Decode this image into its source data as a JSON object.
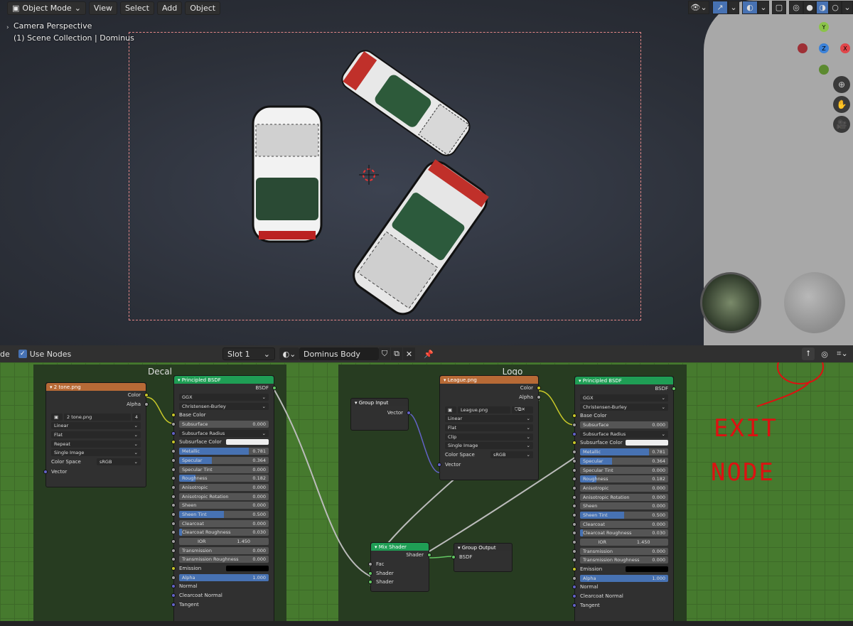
{
  "viewport": {
    "mode": "Object Mode",
    "menus": [
      "View",
      "Select",
      "Add",
      "Object"
    ],
    "overlay_line1": "Camera Perspective",
    "overlay_line2": "(1) Scene Collection | Dominus",
    "axis_labels": {
      "y": "Y",
      "z": "Z",
      "x": "X"
    },
    "nav": [
      "zoom-icon",
      "hand-icon",
      "camera-icon"
    ]
  },
  "node_header": {
    "left_fragment": "de",
    "use_nodes": "Use Nodes",
    "slot": "Slot 1",
    "material": "Dominus Body"
  },
  "frames": {
    "decal": "Decal",
    "logo": "Logo"
  },
  "decal_tex": {
    "title": "2 tone.png",
    "out_color": "Color",
    "out_alpha": "Alpha",
    "image": "2 tone.png",
    "users": "4",
    "interp": "Linear",
    "proj": "Flat",
    "ext": "Repeat",
    "source": "Single Image",
    "colorspace_label": "Color Space",
    "colorspace": "sRGB",
    "in_vector": "Vector"
  },
  "logo_tex": {
    "title": "League.png",
    "out_color": "Color",
    "out_alpha": "Alpha",
    "image": "League.png",
    "interp": "Linear",
    "proj": "Flat",
    "ext": "Clip",
    "source": "Single Image",
    "colorspace_label": "Color Space",
    "colorspace": "sRGB",
    "in_vector": "Vector"
  },
  "group_input": {
    "title": "Group Input",
    "out_vector": "Vector"
  },
  "mix_shader": {
    "title": "Mix Shader",
    "out": "Shader",
    "fac": "Fac",
    "sh1": "Shader",
    "sh2": "Shader"
  },
  "group_output": {
    "title": "Group Output",
    "in": "BSDF"
  },
  "bsdf1": {
    "title": "Principled BSDF",
    "out": "BSDF",
    "dist": "GGX",
    "sss": "Christensen-Burley",
    "base": "Base Color",
    "rows": [
      {
        "label": "Subsurface",
        "value": "0.000",
        "fill": 0
      },
      {
        "label": "Subsurface Radius",
        "value": "",
        "fill": 0,
        "dd": true
      },
      {
        "label": "Subsurface Color",
        "value": "",
        "fill": 0,
        "swatch": "#eeeeee"
      },
      {
        "label": "Metallic",
        "value": "0.781",
        "fill": 0.781
      },
      {
        "label": "Specular",
        "value": "0.364",
        "fill": 0.364
      },
      {
        "label": "Specular Tint",
        "value": "0.000",
        "fill": 0
      },
      {
        "label": "Roughness",
        "value": "0.182",
        "fill": 0.182
      },
      {
        "label": "Anisotropic",
        "value": "0.000",
        "fill": 0
      },
      {
        "label": "Anisotropic Rotation",
        "value": "0.000",
        "fill": 0
      },
      {
        "label": "Sheen",
        "value": "0.000",
        "fill": 0
      },
      {
        "label": "Sheen Tint",
        "value": "0.500",
        "fill": 0.5
      },
      {
        "label": "Clearcoat",
        "value": "0.000",
        "fill": 0
      },
      {
        "label": "Clearcoat Roughness",
        "value": "0.030",
        "fill": 0.03
      },
      {
        "label": "IOR",
        "value": "1.450",
        "fill": 0,
        "center": true
      },
      {
        "label": "Transmission",
        "value": "0.000",
        "fill": 0
      },
      {
        "label": "Transmission Roughness",
        "value": "0.000",
        "fill": 0
      },
      {
        "label": "Emission",
        "value": "",
        "fill": 0,
        "swatch": "#000000"
      },
      {
        "label": "Alpha",
        "value": "1.000",
        "fill": 1
      }
    ],
    "normal": "Normal",
    "cnormal": "Clearcoat Normal",
    "tangent": "Tangent"
  },
  "bsdf2": {
    "title": "Principled BSDF",
    "out": "BSDF",
    "dist": "GGX",
    "sss": "Christensen-Burley",
    "base": "Base Color",
    "rows": [
      {
        "label": "Subsurface",
        "value": "0.000",
        "fill": 0
      },
      {
        "label": "Subsurface Radius",
        "value": "",
        "fill": 0,
        "dd": true
      },
      {
        "label": "Subsurface Color",
        "value": "",
        "fill": 0,
        "swatch": "#eeeeee"
      },
      {
        "label": "Metallic",
        "value": "0.781",
        "fill": 0.781
      },
      {
        "label": "Specular",
        "value": "0.364",
        "fill": 0.364
      },
      {
        "label": "Specular Tint",
        "value": "0.000",
        "fill": 0
      },
      {
        "label": "Roughness",
        "value": "0.182",
        "fill": 0.182
      },
      {
        "label": "Anisotropic",
        "value": "0.000",
        "fill": 0
      },
      {
        "label": "Anisotropic Rotation",
        "value": "0.000",
        "fill": 0
      },
      {
        "label": "Sheen",
        "value": "0.000",
        "fill": 0
      },
      {
        "label": "Sheen Tint",
        "value": "0.500",
        "fill": 0.5
      },
      {
        "label": "Clearcoat",
        "value": "0.000",
        "fill": 0
      },
      {
        "label": "Clearcoat Roughness",
        "value": "0.030",
        "fill": 0.03
      },
      {
        "label": "IOR",
        "value": "1.450",
        "fill": 0,
        "center": true
      },
      {
        "label": "Transmission",
        "value": "0.000",
        "fill": 0
      },
      {
        "label": "Transmission Roughness",
        "value": "0.000",
        "fill": 0
      },
      {
        "label": "Emission",
        "value": "",
        "fill": 0,
        "swatch": "#000000"
      },
      {
        "label": "Alpha",
        "value": "1.000",
        "fill": 1
      }
    ],
    "normal": "Normal",
    "cnormal": "Clearcoat Normal",
    "tangent": "Tangent"
  },
  "annotation": {
    "line1": "EXIT",
    "line2": "NODE",
    "color": "#dd1111"
  }
}
